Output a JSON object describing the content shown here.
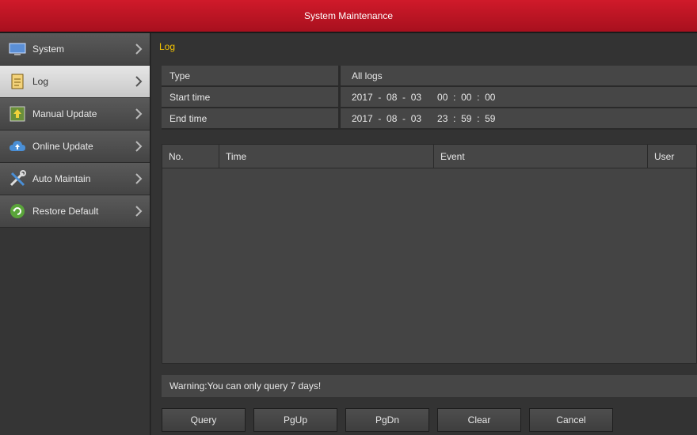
{
  "window": {
    "title": "System Maintenance"
  },
  "sidebar": {
    "items": [
      {
        "label": "System",
        "icon": "monitor-icon",
        "active": false
      },
      {
        "label": "Log",
        "icon": "document-icon",
        "active": true
      },
      {
        "label": "Manual Update",
        "icon": "upload-icon",
        "active": false
      },
      {
        "label": "Online Update",
        "icon": "cloud-icon",
        "active": false
      },
      {
        "label": "Auto Maintain",
        "icon": "tools-icon",
        "active": false
      },
      {
        "label": "Restore Default",
        "icon": "refresh-icon",
        "active": false
      }
    ]
  },
  "main": {
    "section_title": "Log",
    "params": {
      "type_label": "Type",
      "type_value": "All logs",
      "start_label": "Start time",
      "start_value": "2017  -  08  -  03      00  :  00  :  00",
      "end_label": "End time",
      "end_value": "2017  -  08  -  03      23  :  59  :  59"
    },
    "table": {
      "columns": [
        "No.",
        "Time",
        "Event",
        "User"
      ],
      "rows": []
    },
    "warning": "Warning:You can only query 7 days!",
    "buttons": {
      "query": "Query",
      "pgup": "PgUp",
      "pgdn": "PgDn",
      "clear": "Clear",
      "cancel": "Cancel"
    }
  },
  "colors": {
    "titlebar": "#c0141f",
    "section_title": "#f5c400",
    "active_item": "#d9d9d9"
  }
}
